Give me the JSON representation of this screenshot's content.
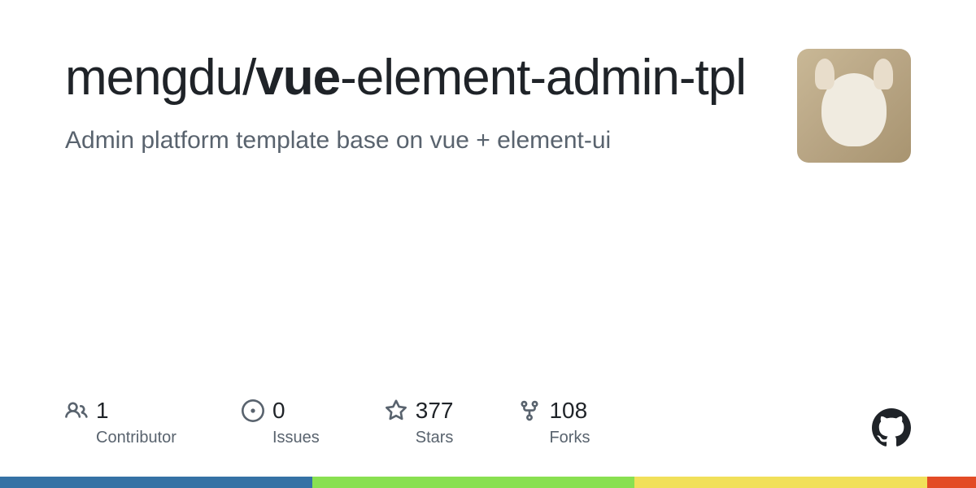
{
  "repo": {
    "owner": "mengdu",
    "separator": "/",
    "name_bold": "vue",
    "name_rest": "-element-admin-tpl",
    "description": "Admin platform template base on vue + element-ui"
  },
  "stats": {
    "contributors": {
      "value": "1",
      "label": "Contributor"
    },
    "issues": {
      "value": "0",
      "label": "Issues"
    },
    "stars": {
      "value": "377",
      "label": "Stars"
    },
    "forks": {
      "value": "108",
      "label": "Forks"
    }
  },
  "colors": {
    "seg1": "#3572A5",
    "seg2": "#89e051",
    "seg3": "#f1e05a",
    "seg4": "#e34c26"
  }
}
